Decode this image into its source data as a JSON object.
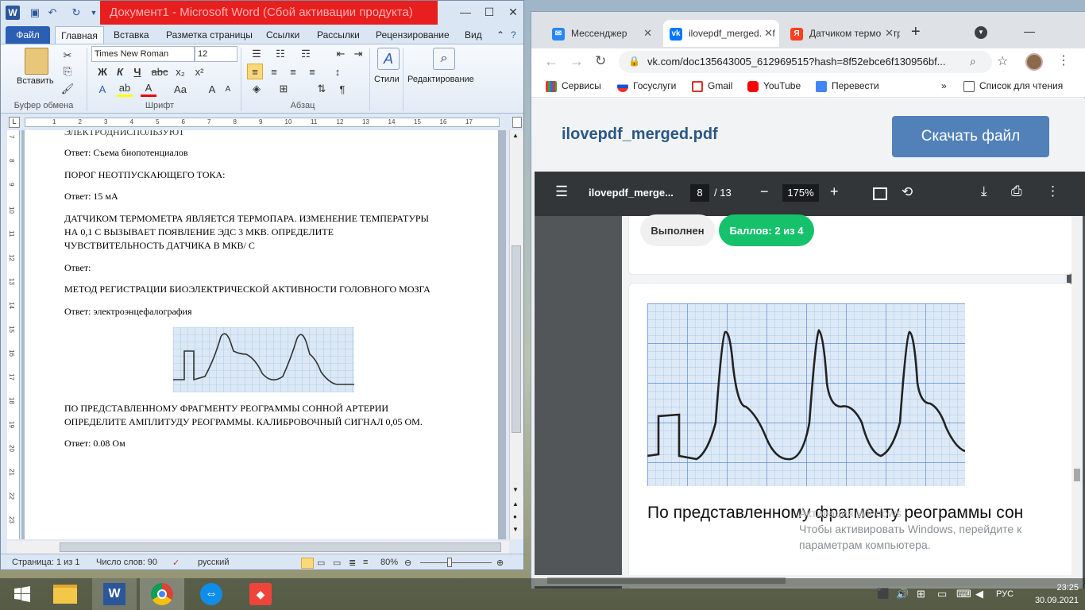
{
  "word": {
    "title": "Документ1  -  Microsoft Word (Сбой активации продукта)",
    "tabs": [
      "Файл",
      "Главная",
      "Вставка",
      "Разметка страницы",
      "Ссылки",
      "Рассылки",
      "Рецензирование",
      "Вид"
    ],
    "ribbon": {
      "paste_label": "Вставить",
      "clipboard_group": "Буфер обмена",
      "font_name": "Times New Roman",
      "font_size": "12",
      "font_group": "Шрифт",
      "paragraph_group": "Абзац",
      "styles_label": "Стили",
      "editing_label": "Редактирование"
    },
    "ruler_h": [
      "1",
      "2",
      "3",
      "4",
      "5",
      "6",
      "7",
      "8",
      "9",
      "10",
      "11",
      "12",
      "13",
      "14",
      "15",
      "16",
      "17"
    ],
    "ruler_v": [
      "7",
      "8",
      "9",
      "10",
      "11",
      "12",
      "13",
      "14",
      "15",
      "16",
      "17",
      "18",
      "19",
      "20",
      "21",
      "22",
      "23"
    ],
    "doc": {
      "line_cut": "ЭЛЕКТРОДНИСПОЛЬЗУЮТ",
      "a1": "Ответ:  Съема биопотенциалов",
      "q2": "ПОРОГ  НЕОТПУСКАЮЩЕГО ТОКА:",
      "a2": "Ответ: 15 мА",
      "q3a": "ДАТЧИКОМ ТЕРМОМЕТРА ЯВЛЯЕТСЯ ТЕРМОПАРА. ИЗМЕНЕНИЕ ТЕМПЕРАТУРЫ",
      "q3b": "НА 0,1 С ВЫЗЫВАЕТ ПОЯВЛЕНИЕ ЭДС 3 МКВ. ОПРЕДЕЛИТЕ",
      "q3c": "ЧУВСТВИТЕЛЬНОСТЬ ДАТЧИКА В МКВ/ С",
      "a3": "Ответ:",
      "q4": "МЕТОД РЕГИСТРАЦИИ БИОЭЛЕКТРИЧЕСКОЙ АКТИВНОСТИ ГОЛОВНОГО МОЗГА",
      "a4": "Ответ: электроэнцефалография",
      "q5a": "ПО ПРЕДСТАВЛЕННОМУ ФРАГМЕНТУ РЕОГРАММЫ СОННОЙ АРТЕРИИ",
      "q5b": "ОПРЕДЕЛИТЕ АМПЛИТУДУ РЕОГРАММЫ. КАЛИБРОВОЧНЫЙ СИГНАЛ 0,05 ОМ.",
      "a5": "Ответ: 0.08 Ом"
    },
    "status": {
      "page": "Страница: 1 из 1",
      "words": "Число слов: 90",
      "lang": "русский",
      "zoom": "80%"
    }
  },
  "chrome": {
    "tabs": [
      {
        "label": "Мессенджер",
        "color": "#2787f5"
      },
      {
        "label": "ilovepdf_merged.pdf",
        "color": "#0077ff"
      },
      {
        "label": "Датчиком термометра",
        "color": "#fc3f1d"
      }
    ],
    "url": "vk.com/doc135643005_612969515?hash=8f52ebce6f130956bf...",
    "bookmarks": [
      "Сервисы",
      "Госуслуги",
      "Gmail",
      "YouTube",
      "Перевести",
      "Список для чтения"
    ],
    "vk": {
      "filename": "ilovepdf_merged.pdf",
      "download": "Скачать файл"
    },
    "pdf": {
      "name": "ilovepdf_merge...",
      "page": "8",
      "total": "/ 13",
      "zoom": "175%",
      "status_done": "Выполнен",
      "score": "Баллов: 2 из 4",
      "question": "По представленному фрагменту реограммы сон"
    }
  },
  "watermark": {
    "line1": "Активация Windows",
    "line2": "Чтобы активировать Windows, перейдите к",
    "line3": "параметрам компьютера."
  },
  "taskbar": {
    "lang": "РУС",
    "time": "23:25",
    "date": "30.09.2021"
  }
}
